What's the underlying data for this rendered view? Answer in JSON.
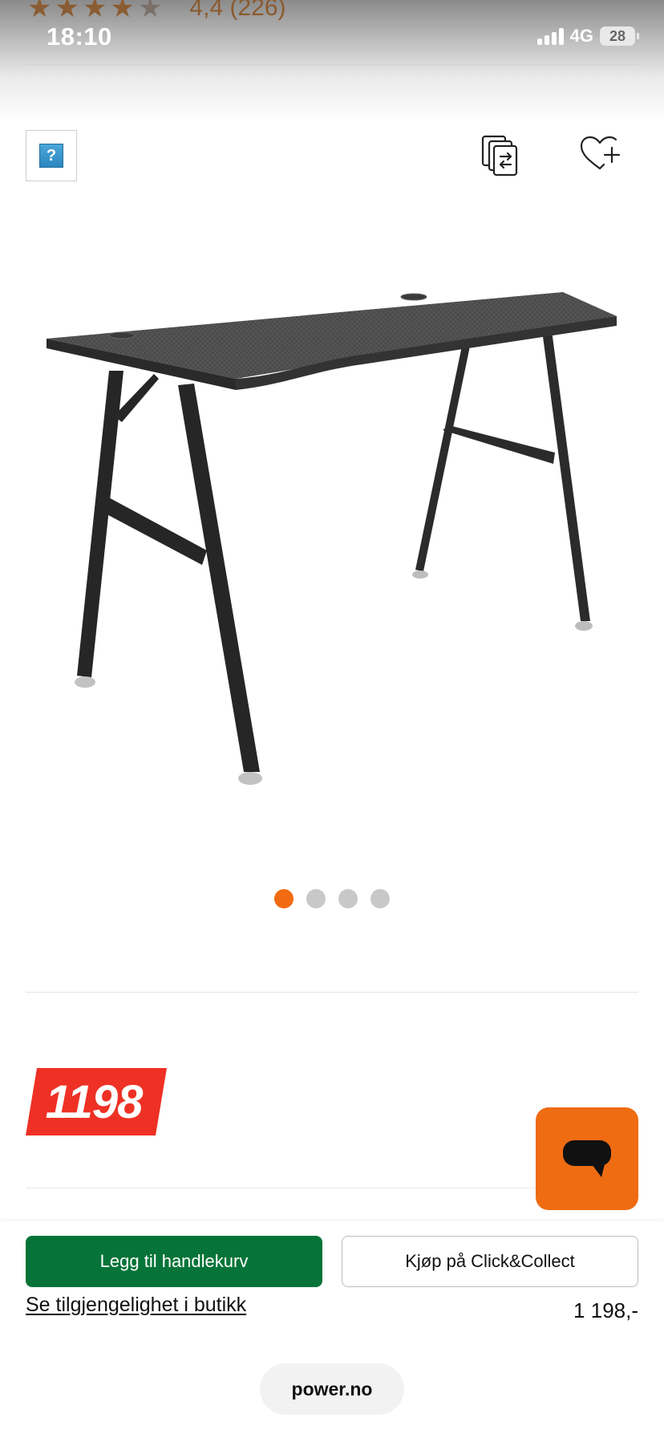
{
  "status_bar": {
    "time": "18:10",
    "network": "4G",
    "battery": "28"
  },
  "rating": {
    "text": "4,4 (226)",
    "value": 4.4,
    "max": 5
  },
  "icons": {
    "help": "help-icon",
    "compare": "compare-icon",
    "wishlist": "heart-plus-icon",
    "chat": "chat-bubble-icon"
  },
  "help_box": {
    "glyph": "?"
  },
  "carousel": {
    "count": 4,
    "active_index": 0
  },
  "price_badge": {
    "value": "1198"
  },
  "actions": {
    "add_to_cart": "Legg til handlekurv",
    "click_collect": "Kjøp på Click&Collect",
    "store_availability": "Se tilgjengelighet i butikk",
    "price": "1 198,-"
  },
  "browser": {
    "url": "power.no"
  },
  "colors": {
    "accent_orange": "#f26a12",
    "cart_green": "#067438",
    "price_red": "#ee3124"
  }
}
